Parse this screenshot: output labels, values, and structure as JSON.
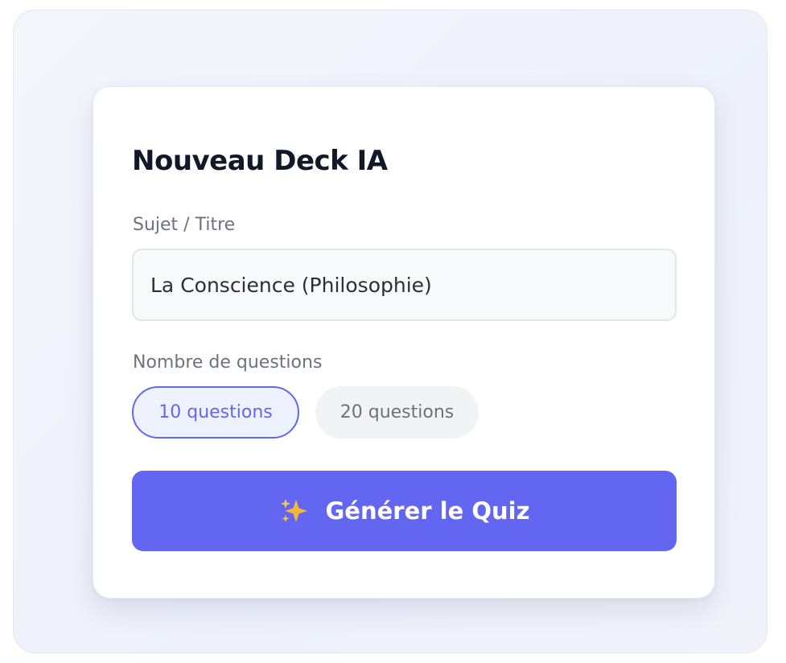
{
  "form": {
    "title": "Nouveau Deck IA",
    "subject_label": "Sujet / Titre",
    "subject_value": "La Conscience (Philosophie)",
    "count_label": "Nombre de questions",
    "options": [
      {
        "label": "10 questions",
        "selected": true
      },
      {
        "label": "20 questions",
        "selected": false
      }
    ],
    "generate_label": "Générer le Quiz",
    "generate_icon": "sparkles-icon"
  },
  "colors": {
    "accent": "#6366f1",
    "selected_chip_bg": "#eef2ff",
    "unselected_chip_bg": "#f2f3f5",
    "title": "#111827",
    "label": "#6b7280",
    "sparkle": "#f5b63c"
  }
}
